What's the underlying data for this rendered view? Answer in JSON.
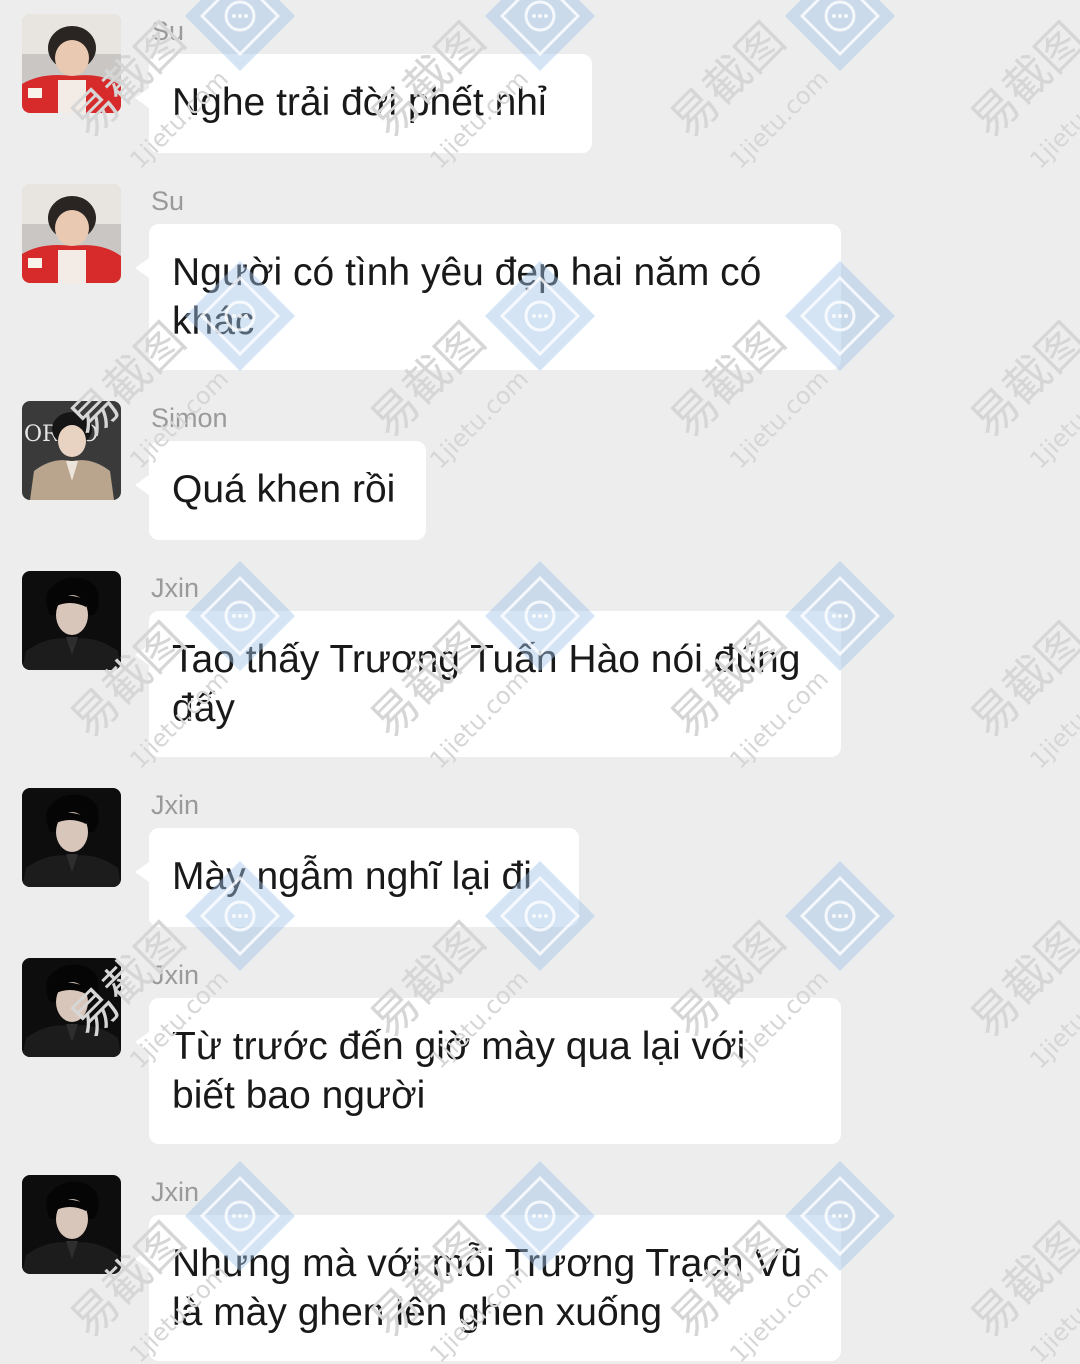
{
  "colors": {
    "background": "#ededed",
    "bubble": "#ffffff",
    "name": "#9a9a9a",
    "text": "#191919"
  },
  "messages": [
    {
      "sender": "Su",
      "avatar_icon": "avatar-su-icon",
      "text": "Nghe trải đời phết nhỉ"
    },
    {
      "sender": "Su",
      "avatar_icon": "avatar-su-icon",
      "text": "Người có tình yêu đẹp hai năm có khác"
    },
    {
      "sender": "Simon",
      "avatar_icon": "avatar-simon-icon",
      "text": "Quá khen rồi"
    },
    {
      "sender": "Jxin",
      "avatar_icon": "avatar-jxin-icon",
      "text": "Tao thấy Trương Tuấn Hào nói đúng đấy"
    },
    {
      "sender": "Jxin",
      "avatar_icon": "avatar-jxin-icon",
      "text": "Mày ngẫm nghĩ lại đi"
    },
    {
      "sender": "Jxin",
      "avatar_icon": "avatar-jxin-icon",
      "text": "Từ trước đến giờ mày qua lại với biết bao người"
    },
    {
      "sender": "Jxin",
      "avatar_icon": "avatar-jxin-icon",
      "text": "Nhưng mà với mỗi Trương Trạch Vũ là mày ghen lên ghen xuống"
    }
  ],
  "watermark": {
    "brand": "易截图",
    "site": "1jietu.com"
  }
}
